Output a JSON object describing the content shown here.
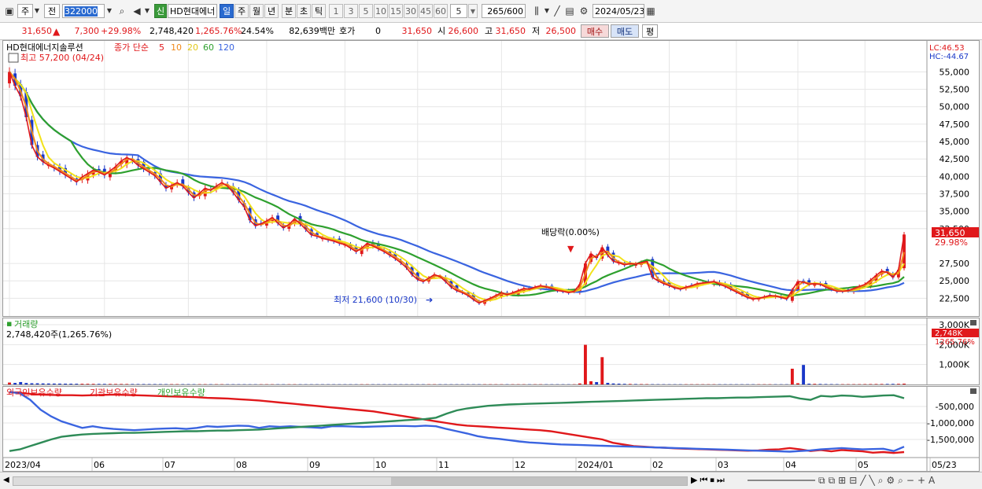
{
  "toolbar": {
    "chart_type": "주",
    "prev": "전",
    "code": "322000",
    "market_badge": "신",
    "name": "HD현대에너",
    "periods": [
      "일",
      "주",
      "월",
      "년",
      "분",
      "초",
      "틱"
    ],
    "active_period": "일",
    "minutes": [
      "1",
      "3",
      "5",
      "10",
      "15",
      "30",
      "45",
      "60"
    ],
    "minute_select": "5",
    "count": "265",
    "count_total": "/600",
    "date": "2024/05/23"
  },
  "quote": {
    "price": "31,650",
    "arrow": "▲",
    "change": "7,300",
    "change_pct": "+29.98%",
    "volume": "2,748,420",
    "volume_pct": "1,265.76%",
    "turnover": "24.54%",
    "trade_value": "82,639백만",
    "hoga_label": "호가",
    "hoga_value": "0",
    "hoga_price": "31,650",
    "open_label": "시",
    "open": "26,600",
    "high_label": "고",
    "high": "31,650",
    "low_label": "저",
    "low": "26,500",
    "buy": "매수",
    "sell": "매도",
    "eval": "평"
  },
  "colors": {
    "up": "#e0181b",
    "down": "#1a38c8",
    "ma5": "#e0181b",
    "ma10": "#f08a1c",
    "ma20": "#f2e21a",
    "ma60": "#2ea02e",
    "ma120": "#3a64e0"
  },
  "chart_data": [
    {
      "type": "candlestick",
      "title": "HD현대에너지솔루션",
      "legend_label": "종가 단순",
      "ma_periods": [
        "5",
        "10",
        "20",
        "60",
        "120"
      ],
      "lc": "LC:46.53",
      "hc": "HC:-44.67",
      "yticks": [
        "55,000",
        "52,500",
        "50,000",
        "47,500",
        "45,000",
        "42,500",
        "40,000",
        "37,500",
        "35,000",
        "32,500",
        "27,500",
        "25,000",
        "22,500"
      ],
      "ylim": [
        20400,
        59000
      ],
      "xlabels": [
        "2023/04",
        "06",
        "07",
        "08",
        "09",
        "10",
        "11",
        "12",
        "2024/01",
        "02",
        "03",
        "04",
        "05",
        "05/23"
      ],
      "annot_high": "최고 57,200 (04/24)",
      "annot_low": "최저 21,600 (10/30)",
      "annot_dividend": "배당락(0.00%)",
      "last_price_label": "31,650",
      "last_pct_label": "29.98%",
      "closes": [
        55000,
        53000,
        51500,
        48500,
        44500,
        42800,
        42100,
        41600,
        41200,
        40700,
        40200,
        39700,
        39200,
        39900,
        40400,
        40900,
        40600,
        40200,
        40800,
        41400,
        42200,
        42700,
        42300,
        41600,
        41100,
        40600,
        40100,
        39200,
        38300,
        38700,
        39100,
        38600,
        37700,
        36900,
        37600,
        38300,
        38000,
        38600,
        39100,
        38600,
        37700,
        36600,
        35600,
        33700,
        32900,
        33200,
        33600,
        34100,
        33300,
        32600,
        33100,
        33900,
        33200,
        32400,
        31600,
        31400,
        31100,
        30900,
        30700,
        30400,
        30200,
        29700,
        29200,
        29700,
        30400,
        30000,
        29600,
        29200,
        28700,
        28200,
        27600,
        26900,
        25900,
        25200,
        24900,
        25400,
        25900,
        25600,
        24900,
        24100,
        23600,
        23300,
        22900,
        22300,
        21800,
        22200,
        22500,
        22900,
        23300,
        23000,
        23300,
        23600,
        23900,
        23800,
        24100,
        24300,
        24100,
        23900,
        23600,
        23500,
        23300,
        23500,
        24500,
        27500,
        28900,
        28300,
        29800,
        28700,
        27800,
        27600,
        27300,
        27500,
        27400,
        27600,
        27800,
        25500,
        25000,
        24600,
        24300,
        24000,
        23800,
        24100,
        24300,
        24600,
        24700,
        24800,
        24900,
        24500,
        24200,
        23800,
        23400,
        23000,
        22600,
        22400,
        22500,
        22700,
        22900,
        22800,
        22600,
        22400,
        23700,
        24900,
        24800,
        24500,
        24600,
        24500,
        24100,
        23800,
        23500,
        23500,
        23600,
        23900,
        24200,
        24500,
        25100,
        25800,
        26400,
        26200,
        25500,
        26600,
        31650
      ],
      "volumes": [
        95000,
        78000,
        120000,
        75000,
        60000,
        58000,
        52000,
        48000,
        45000,
        42000,
        40000,
        38000,
        36000,
        34000,
        32000,
        30000,
        28000,
        27000,
        26000,
        25000,
        24000,
        23000,
        22000,
        21000,
        20000,
        19000,
        19000,
        18000,
        17000,
        17000,
        17000,
        16000,
        16000,
        15000,
        15000,
        15000,
        14000,
        14000,
        14000,
        13000,
        13000,
        13000,
        13000,
        12000,
        12000,
        12000,
        12000,
        12000,
        12000,
        12000,
        12000,
        12000,
        12000,
        12000,
        12000,
        12000,
        12000,
        12000,
        12000,
        12000,
        12000,
        12000,
        12000,
        12000,
        12000,
        12000,
        12000,
        12000,
        12000,
        12000,
        12000,
        12000,
        12000,
        12000,
        12000,
        12000,
        12000,
        12000,
        12000,
        12000,
        12000,
        12000,
        12000,
        12000,
        12000,
        12000,
        12000,
        12000,
        12000,
        12000,
        12000,
        12000,
        12000,
        12000,
        12000,
        12000,
        12000,
        12000,
        12000,
        12000,
        12000,
        12000,
        50000,
        1990000,
        160000,
        120000,
        1370000,
        80000,
        50000,
        40000,
        30000,
        25000,
        20000,
        18000,
        16000,
        15000,
        14000,
        13000,
        12000,
        12000,
        12000,
        12000,
        12000,
        12000,
        12000,
        12000,
        12000,
        12000,
        12000,
        12000,
        12000,
        12000,
        12000,
        12000,
        12000,
        12000,
        12000,
        12000,
        12000,
        12000,
        790000,
        60000,
        980000,
        40000,
        30000,
        25000,
        20000,
        18000,
        16000,
        15000,
        15000,
        15000,
        15000,
        18000,
        20000,
        22000,
        24000,
        26000,
        28000,
        30000,
        40000,
        45000,
        2748420
      ]
    },
    {
      "type": "bar",
      "title": "거래량",
      "value_label": "2,748,420주(1,265.76%)",
      "yticks": [
        "3,000K",
        "2,000K",
        "1,000K"
      ],
      "last_label": "2,748K",
      "last_pct_label": "1265.76%"
    },
    {
      "type": "line",
      "series": [
        {
          "name": "외국인보유수량",
          "values": [
            -70000,
            -90000,
            -120000,
            -140000,
            -150000,
            -160000,
            -160000,
            -170000,
            -160000,
            -150000,
            -140000,
            -150000,
            -160000,
            -170000,
            -180000,
            -190000,
            -200000,
            -210000,
            -220000,
            -240000,
            -250000,
            -260000,
            -280000,
            -300000,
            -320000,
            -350000,
            -380000,
            -410000,
            -440000,
            -470000,
            -500000,
            -530000,
            -560000,
            -590000,
            -620000,
            -650000,
            -700000,
            -750000,
            -800000,
            -850000,
            -900000,
            -950000,
            -1000000,
            -1050000,
            -1080000,
            -1100000,
            -1120000,
            -1140000,
            -1160000,
            -1180000,
            -1200000,
            -1220000,
            -1250000,
            -1300000,
            -1350000,
            -1400000,
            -1450000,
            -1500000,
            -1600000,
            -1650000,
            -1700000,
            -1720000,
            -1740000,
            -1750000,
            -1770000,
            -1780000,
            -1790000,
            -1800000,
            -1810000,
            -1820000,
            -1830000,
            -1840000,
            -1830000,
            -1810000,
            -1800000,
            -1760000,
            -1800000,
            -1850000,
            -1820000,
            -1860000,
            -1820000,
            -1840000,
            -1860000,
            -1900000,
            -1880000,
            -1910000,
            -1880000
          ]
        },
        {
          "name": "기관보유수량",
          "values": [
            -60000,
            -100000,
            -300000,
            -600000,
            -800000,
            -950000,
            -1050000,
            -1150000,
            -1100000,
            -1150000,
            -1180000,
            -1200000,
            -1220000,
            -1200000,
            -1180000,
            -1170000,
            -1160000,
            -1180000,
            -1150000,
            -1100000,
            -1120000,
            -1100000,
            -1080000,
            -1090000,
            -1150000,
            -1100000,
            -1120000,
            -1100000,
            -1120000,
            -1130000,
            -1150000,
            -1100000,
            -1100000,
            -1110000,
            -1120000,
            -1110000,
            -1100000,
            -1090000,
            -1090000,
            -1100000,
            -1080000,
            -1100000,
            -1180000,
            -1250000,
            -1320000,
            -1400000,
            -1450000,
            -1480000,
            -1520000,
            -1560000,
            -1590000,
            -1610000,
            -1630000,
            -1650000,
            -1660000,
            -1670000,
            -1680000,
            -1690000,
            -1700000,
            -1710000,
            -1720000,
            -1730000,
            -1740000,
            -1750000,
            -1760000,
            -1770000,
            -1780000,
            -1790000,
            -1800000,
            -1810000,
            -1820000,
            -1830000,
            -1840000,
            -1850000,
            -1860000,
            -1870000,
            -1850000,
            -1830000,
            -1800000,
            -1780000,
            -1760000,
            -1780000,
            -1800000,
            -1790000,
            -1780000,
            -1850000,
            -1720000
          ]
        },
        {
          "name": "개인보유수량",
          "values": [
            -1850000,
            -1800000,
            -1700000,
            -1600000,
            -1500000,
            -1420000,
            -1380000,
            -1350000,
            -1330000,
            -1320000,
            -1310000,
            -1300000,
            -1300000,
            -1290000,
            -1280000,
            -1270000,
            -1260000,
            -1250000,
            -1250000,
            -1240000,
            -1230000,
            -1230000,
            -1220000,
            -1210000,
            -1200000,
            -1180000,
            -1160000,
            -1140000,
            -1120000,
            -1100000,
            -1080000,
            -1060000,
            -1040000,
            -1020000,
            -1000000,
            -980000,
            -960000,
            -940000,
            -920000,
            -900000,
            -880000,
            -840000,
            -720000,
            -620000,
            -560000,
            -520000,
            -480000,
            -460000,
            -440000,
            -430000,
            -420000,
            -410000,
            -400000,
            -390000,
            -380000,
            -370000,
            -360000,
            -350000,
            -340000,
            -330000,
            -320000,
            -310000,
            -300000,
            -290000,
            -280000,
            -270000,
            -260000,
            -250000,
            -250000,
            -240000,
            -230000,
            -230000,
            -220000,
            -210000,
            -200000,
            -190000,
            -260000,
            -300000,
            -180000,
            -200000,
            -170000,
            -180000,
            -210000,
            -190000,
            -170000,
            -160000,
            -250000
          ]
        }
      ],
      "yticks": [
        "-500,000",
        "-1,000,000",
        "-1,500,000"
      ],
      "ylim": [
        -2000000,
        0
      ]
    }
  ]
}
